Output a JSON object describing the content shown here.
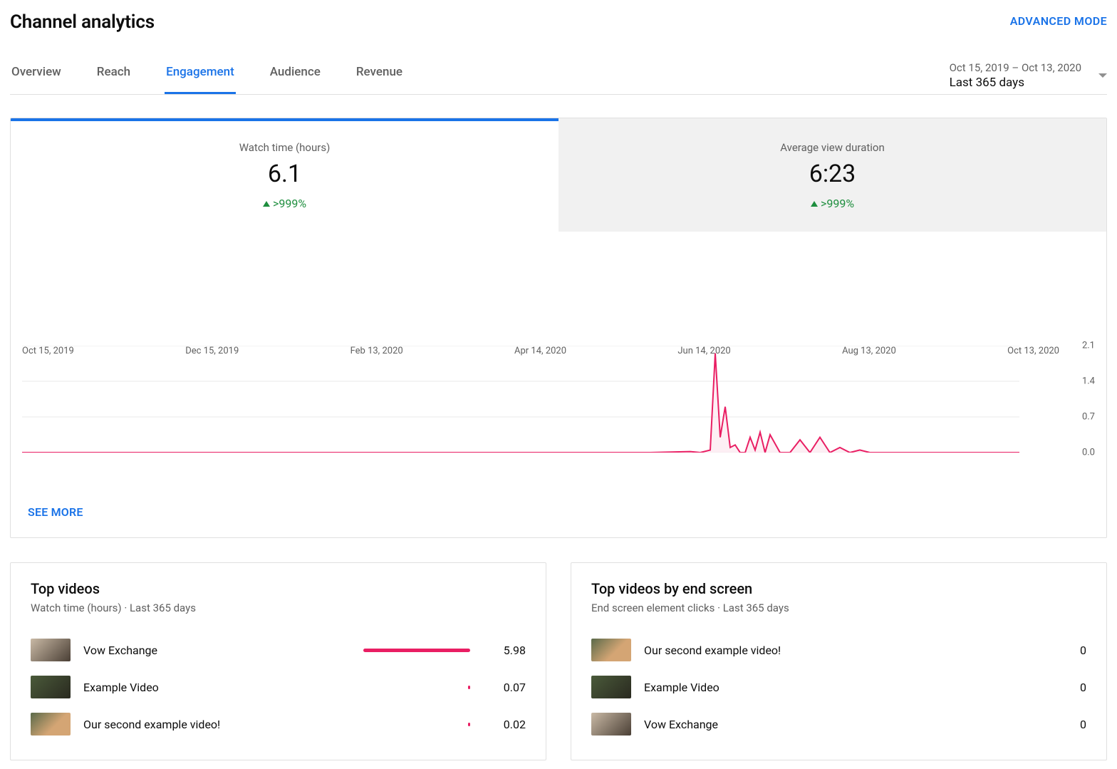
{
  "header": {
    "title": "Channel analytics",
    "advanced_mode": "ADVANCED MODE"
  },
  "tabs": {
    "items": [
      "Overview",
      "Reach",
      "Engagement",
      "Audience",
      "Revenue"
    ],
    "active_index": 2
  },
  "date_picker": {
    "range": "Oct 15, 2019 – Oct 13, 2020",
    "label": "Last 365 days"
  },
  "metrics": [
    {
      "label": "Watch time (hours)",
      "value": "6.1",
      "change": ">999%",
      "active": true
    },
    {
      "label": "Average view duration",
      "value": "6:23",
      "change": ">999%",
      "active": false
    }
  ],
  "chart_data": {
    "type": "area",
    "ylabel": "",
    "ylim": [
      0,
      2.1
    ],
    "y_ticks": [
      "2.1",
      "1.4",
      "0.7",
      "0.0"
    ],
    "x_ticks": [
      "Oct 15, 2019",
      "Dec 15, 2019",
      "Feb 13, 2020",
      "Apr 14, 2020",
      "Jun 14, 2020",
      "Aug 13, 2020",
      "Oct 13, 2020"
    ],
    "series": [
      {
        "name": "Watch time (hours)",
        "x_frac": [
          0.0,
          0.62,
          0.63,
          0.67,
          0.68,
          0.69,
          0.695,
          0.7,
          0.705,
          0.71,
          0.715,
          0.72,
          0.725,
          0.73,
          0.735,
          0.74,
          0.745,
          0.75,
          0.76,
          0.77,
          0.78,
          0.79,
          0.8,
          0.81,
          0.82,
          0.83,
          0.84,
          0.85,
          0.94,
          1.0
        ],
        "values": [
          0.0,
          0.0,
          0.0,
          0.02,
          0.0,
          0.05,
          1.95,
          0.3,
          0.9,
          0.1,
          0.15,
          0.0,
          0.0,
          0.3,
          0.05,
          0.4,
          0.0,
          0.35,
          0.0,
          0.0,
          0.25,
          0.0,
          0.3,
          0.0,
          0.1,
          0.0,
          0.05,
          0.0,
          0.0,
          0.0
        ]
      }
    ]
  },
  "see_more": "SEE MORE",
  "top_videos": {
    "title": "Top videos",
    "subtitle": "Watch time (hours) · Last 365 days",
    "rows": [
      {
        "name": "Vow Exchange",
        "value": "5.98",
        "bar_pct": 100,
        "thumb": "t1"
      },
      {
        "name": "Example Video",
        "value": "0.07",
        "bar_pct": 2,
        "thumb": "t2"
      },
      {
        "name": "Our second example video!",
        "value": "0.02",
        "bar_pct": 1,
        "thumb": "t3"
      }
    ]
  },
  "top_end_screen": {
    "title": "Top videos by end screen",
    "subtitle": "End screen element clicks · Last 365 days",
    "rows": [
      {
        "name": "Our second example video!",
        "value": "0",
        "thumb": "t3"
      },
      {
        "name": "Example Video",
        "value": "0",
        "thumb": "t2"
      },
      {
        "name": "Vow Exchange",
        "value": "0",
        "thumb": "t1"
      }
    ]
  }
}
